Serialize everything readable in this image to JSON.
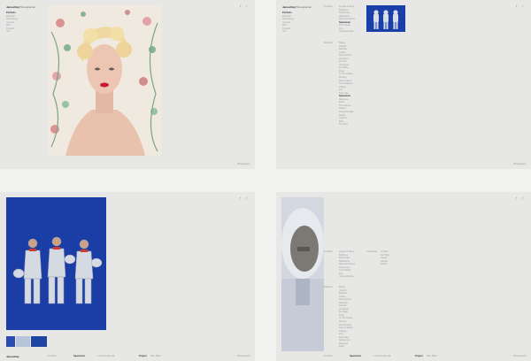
{
  "site": {
    "logo_bold": "JamesDay",
    "logo_rest": "Photographer",
    "social": [
      "f",
      "t"
    ],
    "footer_right": "Photography"
  },
  "nav_items": [
    "Portfolio",
    "Editorial",
    "Advertising",
    "Journal",
    "Film",
    "Contact",
    "Info"
  ],
  "panel1": {},
  "panel2": {
    "section_a": "Portfolio",
    "section_b": "Editorial",
    "list_a": [
      "Angels & Bees",
      "Bathtime",
      "Fisherman",
      "Madeleine",
      "Mammal Mama",
      "Spacemen",
      "Twin Peaks",
      "Zoo",
      "Unsustainable"
    ],
    "list_a_active": "Spacemen",
    "list_b": [
      "Bailey",
      "Atlantic",
      "Bubbles",
      "Chairs",
      "Mannequins",
      "Monkeys",
      "Portrait",
      "Overseas",
      "Fur Baby",
      "Dogs",
      "In The Studio",
      "Moving",
      "Murmuration",
      "New Zealand",
      "Tidings",
      "Zoo",
      "Dark Sea",
      "Spacemen",
      "Marquee",
      "Dolls",
      "The Gloves",
      "Waves",
      "Unsustainable",
      "Fields",
      "Yoghurt",
      "Blue",
      "Fire Bird"
    ],
    "list_b_active": "Spacemen"
  },
  "panel3": {
    "footer_items": [
      "Portfolio",
      "Spacemen",
      "1 Thumbnails (9)",
      "Project",
      "Map",
      "Beta"
    ],
    "active_item": "Spacemen"
  },
  "panel4": {
    "section_a": "Portfolio",
    "section_b": "Editorial",
    "list_a": [
      "Angels & Bees",
      "Bathtime",
      "Fisherman",
      "Madeleine",
      "Mammal Mama",
      "Spacemen",
      "Twin Peaks",
      "Zoo",
      "Unsustainable"
    ],
    "list_b": [
      "Bailey",
      "Atlantic",
      "Bubbles",
      "Chairs",
      "Mannequins",
      "Monkeys",
      "Portrait",
      "Overseas",
      "Fur Baby",
      "Dogs",
      "In The Studio",
      "Moving",
      "Murmuration",
      "New Zealand",
      "Tidings",
      "Zoo",
      "Dark Sea",
      "Spacemen",
      "Marquee",
      "Dolls"
    ],
    "section_c": "Landscape",
    "list_c": [
      "Art Film",
      "Fur Baby",
      "Heads",
      "Rebels",
      "Fields"
    ],
    "footer_items": [
      "Portfolio",
      "Spacemen",
      "1 Thumbnails (9)",
      "Project",
      "Map",
      "Beta"
    ]
  },
  "colors": {
    "panel_bg": "#e7e7e6",
    "page_bg": "#f1f1f0",
    "spacemen_blue": "#1a3fa8"
  }
}
